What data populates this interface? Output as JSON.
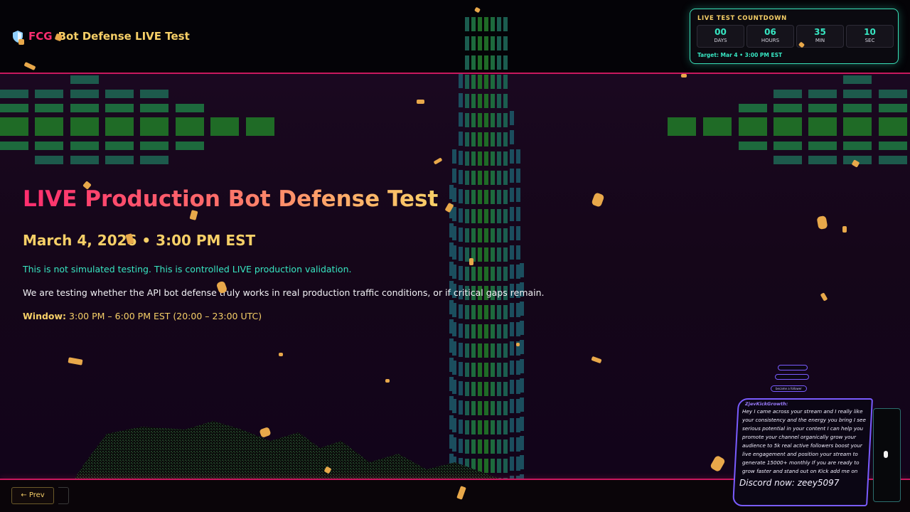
{
  "brand": {
    "accent": "FCG",
    "title": "Bot Defense LIVE Test",
    "icon": "shield-icon"
  },
  "countdown": {
    "heading": "LIVE TEST COUNTDOWN",
    "cells": [
      {
        "value": "00",
        "label": "DAYS"
      },
      {
        "value": "06",
        "label": "HOURS"
      },
      {
        "value": "35",
        "label": "MIN"
      },
      {
        "value": "10",
        "label": "SEC"
      }
    ],
    "target": "Target: Mar 4 • 3:00 PM EST"
  },
  "hero": {
    "title": "LIVE Production Bot Defense Test",
    "date": "March 4, 2026 • 3:00 PM EST",
    "line1": "This is not simulated testing. This is controlled LIVE production validation.",
    "line2": "We are testing whether the API bot defense truly works in real production traffic conditions, or if critical gaps remain.",
    "window_label": "Window:",
    "window_value": "3:00 PM – 6:00 PM EST (20:00 – 23:00 UTC)"
  },
  "nav": {
    "prev_label": "← Prev"
  },
  "chat": {
    "small_msg": "became a follower",
    "username": "ZjevKickGrowth:",
    "message": "Hey I came across your stream and I really like your consistency and the energy you bring I see serious potential in your content I can help you promote your channel organically grow your audience to 5k real active followers boost your live engagement and position your stream to generate 15000+ monthly If you are ready to grow faster and stand out on Kick add me on",
    "tag": "Discord now: zeey5097"
  },
  "colors": {
    "accent_pink": "#ff2d6f",
    "gold": "#f6cf67",
    "teal": "#37e6c2",
    "purple": "#7a5cff"
  }
}
